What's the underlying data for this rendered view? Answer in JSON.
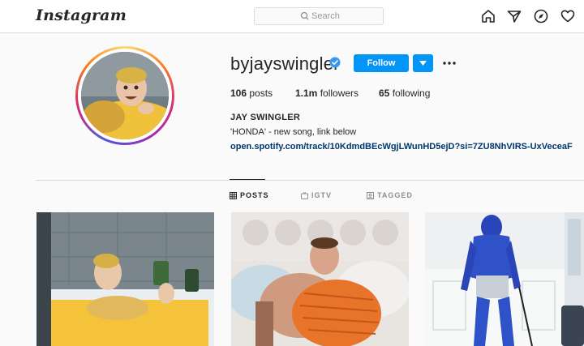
{
  "nav": {
    "logo": "Instagram",
    "search_placeholder": "Search",
    "icons": [
      "home-icon",
      "direct-icon",
      "explore-icon",
      "activity-heart-icon"
    ]
  },
  "profile": {
    "username": "byjayswingler",
    "verified": true,
    "follow_label": "Follow",
    "stats": {
      "posts_count": "106",
      "posts_label": "posts",
      "followers_count": "1.1m",
      "followers_label": "followers",
      "following_count": "65",
      "following_label": "following"
    },
    "full_name": "JAY SWINGLER",
    "bio": "'HONDA' - new song, link below",
    "link": "open.spotify.com/track/10KdmdBEcWgjLWunHD5ejD?si=7ZU8NhVIRS-UxVeceaF"
  },
  "tabs": [
    {
      "label": "POSTS",
      "active": true
    },
    {
      "label": "IGTV",
      "active": false
    },
    {
      "label": "TAGGED",
      "active": false
    }
  ],
  "colors": {
    "accent": "#0095f6",
    "link": "#00376b",
    "text": "#262626",
    "muted": "#8e8e8e"
  }
}
